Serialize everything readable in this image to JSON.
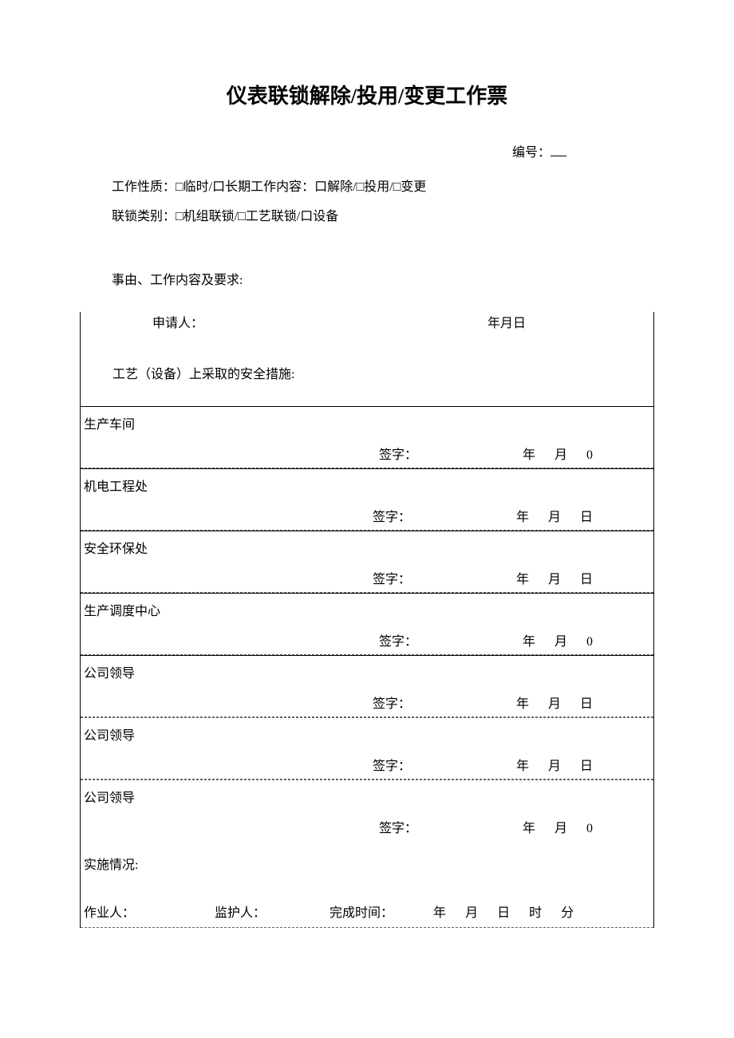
{
  "title": "仪表联锁解除/投用/变更工作票",
  "serial": {
    "label": "编号："
  },
  "work_nature": {
    "label": "工作性质：",
    "options": "□临时/口长期",
    "content_label": "工作内容：",
    "content_options": "口解除/□投用/□变更"
  },
  "interlock_type": {
    "label": "联锁类别：",
    "options": "□机组联锁/□工艺联锁/口设备"
  },
  "reason_label": "事由、工作内容及要求:",
  "applicant": {
    "label": "申请人：",
    "date_label": "年月日"
  },
  "safety_label": "工艺（设备）上采取的安全措施:",
  "sig_label": "签字：",
  "date_parts": {
    "year": "年",
    "month": "月",
    "day": "日",
    "zero": "0",
    "hour": "时",
    "min": "分"
  },
  "rows": [
    {
      "dept": "生产车间",
      "day": "0",
      "dashed": false
    },
    {
      "dept": "机电工程处",
      "day": "日",
      "dashed": false
    },
    {
      "dept": "安全环保处",
      "day": "日",
      "dashed": false
    },
    {
      "dept": "生产调度中心",
      "day": "0",
      "dashed": false
    },
    {
      "dept": "公司领导",
      "day": "日",
      "dashed": false
    },
    {
      "dept": "公司领导",
      "day": "日",
      "dashed": true
    },
    {
      "dept": "公司领导",
      "day": "0",
      "dashed": true
    }
  ],
  "impl": {
    "label": "实施情况:"
  },
  "bottom": {
    "operator": "作业人：",
    "guardian": "监护人：",
    "finish": "完成时间："
  }
}
